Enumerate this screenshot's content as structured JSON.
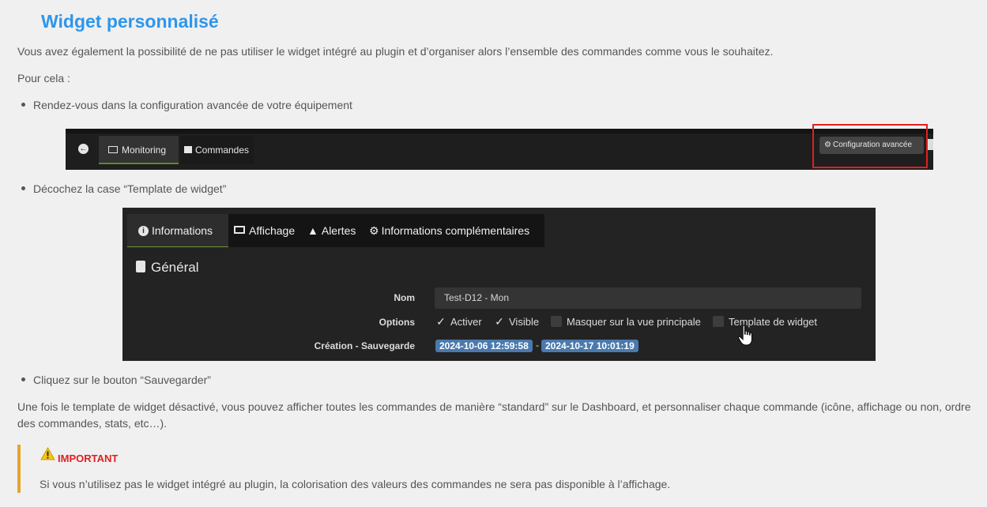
{
  "heading": "Widget personnalisé",
  "intro": "Vous avez également la possibilité de ne pas utiliser le widget intégré au plugin et d’organiser alors l’ensemble des commandes comme vous le souhaitez.",
  "pour_cela": "Pour cela :",
  "steps": [
    "Rendez-vous dans la configuration avancée de votre équipement",
    "Décochez la case “Template de widget”",
    "Cliquez sur le bouton “Sauvegarder”"
  ],
  "screenshot1": {
    "tab_monitoring": "Monitoring",
    "tab_commandes": "Commandes",
    "config_button": "Configuration avancée"
  },
  "screenshot2": {
    "tabs": [
      "Informations",
      "Affichage",
      "Alertes",
      "Informations complémentaires"
    ],
    "section_title": "Général",
    "nom_label": "Nom",
    "nom_value": "Test-D12 - Mon",
    "options_label": "Options",
    "options": [
      {
        "label": "Activer",
        "checked": true
      },
      {
        "label": "Visible",
        "checked": true
      },
      {
        "label": "Masquer sur la vue principale",
        "checked": false
      },
      {
        "label": "Template de widget",
        "checked": false
      }
    ],
    "creation_label": "Création - Sauvegarde",
    "creation_date": "2024-10-06 12:59:58",
    "date_separator": "-",
    "save_date": "2024-10-17 10:01:19"
  },
  "outro_line1": "Une fois le template de widget désactivé, vous pouvez afficher toutes les commandes de manière “standard” sur le Dashboard, et personnaliser chaque commande (icône, affichage ou non, ordre",
  "outro_line2": "des commandes, stats, etc…).",
  "note": {
    "title": "IMPORTANT",
    "text": "Si vous n’utilisez pas le widget intégré au plugin, la colorisation des valeurs des commandes ne sera pas disponible à l’affichage."
  },
  "colors": {
    "heading": "#2d96ec",
    "highlight_box": "#e02020",
    "note_bar": "#e6a32e",
    "date_badge": "#4a79ad"
  }
}
